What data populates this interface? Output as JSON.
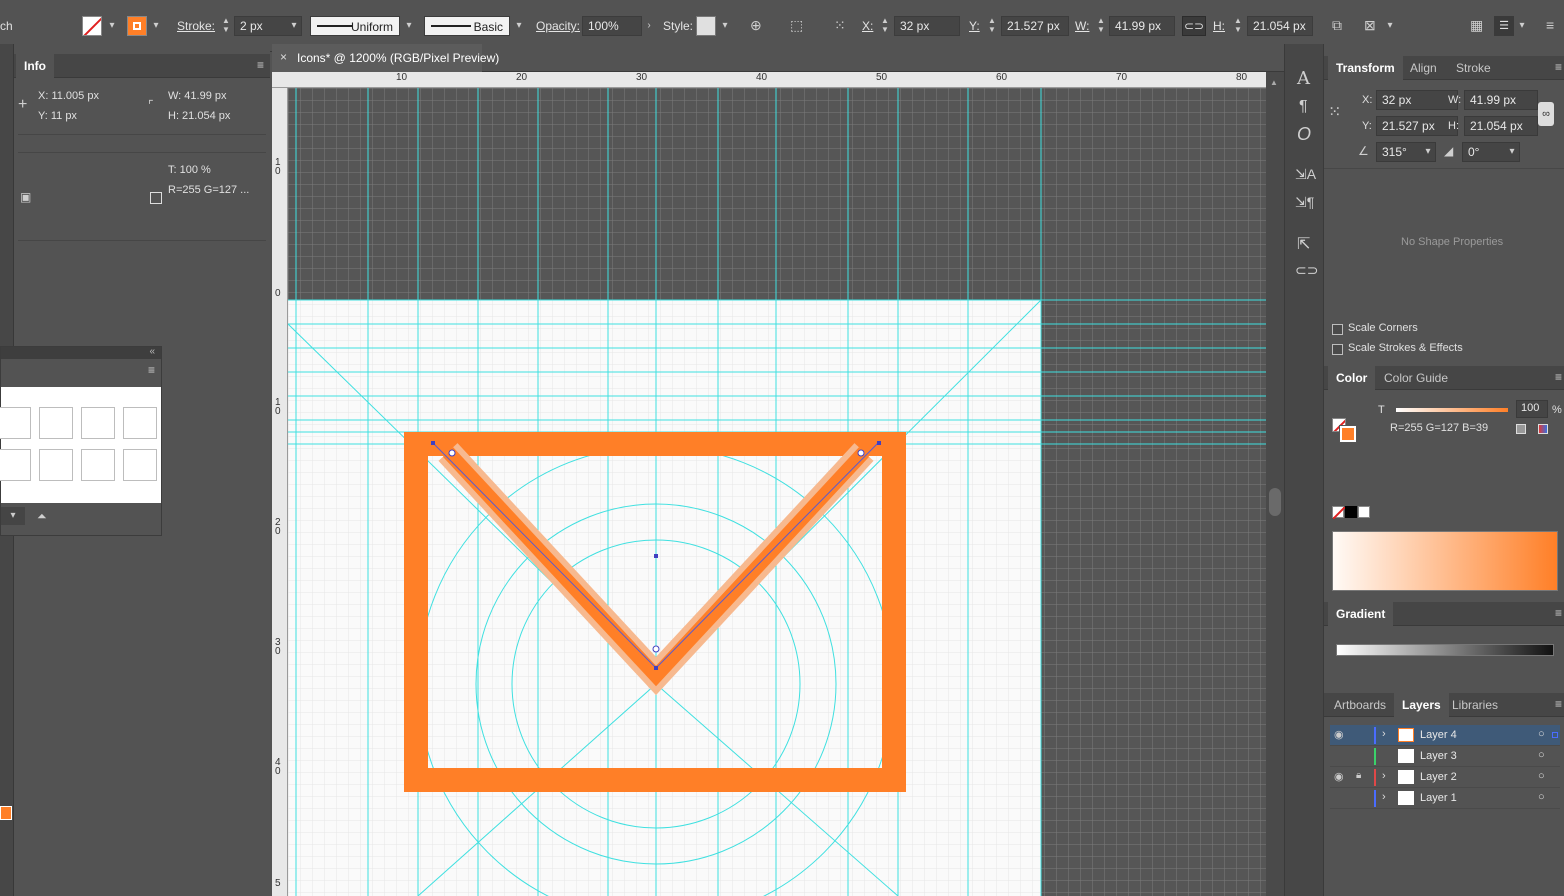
{
  "control_bar": {
    "stroke_label": "Stroke:",
    "stroke_weight": "2 px",
    "profile": "Uniform",
    "brush": "Basic",
    "opacity_label": "Opacity:",
    "opacity": "100%",
    "style_label": "Style:",
    "x_label": "X:",
    "x": "32 px",
    "y_label": "Y:",
    "y": "21.527 px",
    "w_label": "W:",
    "w": "41.99 px",
    "h_label": "H:",
    "h": "21.054 px",
    "left_cut": "ch"
  },
  "info_panel": {
    "tab": "Info",
    "x": "X: 11.005 px",
    "y": "Y: 11 px",
    "w": "W:  41.99 px",
    "h": "H:  21.054 px",
    "t": "T: 100 %",
    "rgb": "R=255 G=127 ..."
  },
  "document": {
    "tab_title": "Icons* @ 1200% (RGB/Pixel Preview)",
    "ruler_top": [
      "10",
      "20",
      "30",
      "40",
      "50",
      "60",
      "70",
      "80"
    ],
    "ruler_left": [
      "1 0",
      "0",
      "1 0",
      "2 0",
      "3 0",
      "4 0",
      "5"
    ]
  },
  "transform_panel": {
    "tabs": [
      "Transform",
      "Align",
      "Stroke"
    ],
    "x_label": "X:",
    "x": "32 px",
    "y_label": "Y:",
    "y": "21.527 px",
    "w_label": "W:",
    "w": "41.99 px",
    "h_label": "H:",
    "h": "21.054 px",
    "angle": "315°",
    "shear": "0°",
    "no_shape": "No Shape Properties",
    "scale_corners": "Scale Corners",
    "scale_strokes": "Scale Strokes & Effects"
  },
  "color_panel": {
    "tabs": [
      "Color",
      "Color Guide"
    ],
    "t_label": "T",
    "tint": "100",
    "percent": "%",
    "rgb": "R=255 G=127 B=39"
  },
  "gradient_panel": {
    "tab": "Gradient"
  },
  "layers_panel": {
    "tabs": [
      "Artboards",
      "Layers",
      "Libraries"
    ],
    "layers": [
      {
        "name": "Layer 4",
        "color": "#4a6cff"
      },
      {
        "name": "Layer 3",
        "color": "#3bd16a"
      },
      {
        "name": "Layer 2",
        "color": "#e04848"
      },
      {
        "name": "Layer 1",
        "color": "#4a6cff"
      }
    ]
  },
  "colors": {
    "accent": "#ff7f27",
    "guide": "#3fe0e0"
  }
}
